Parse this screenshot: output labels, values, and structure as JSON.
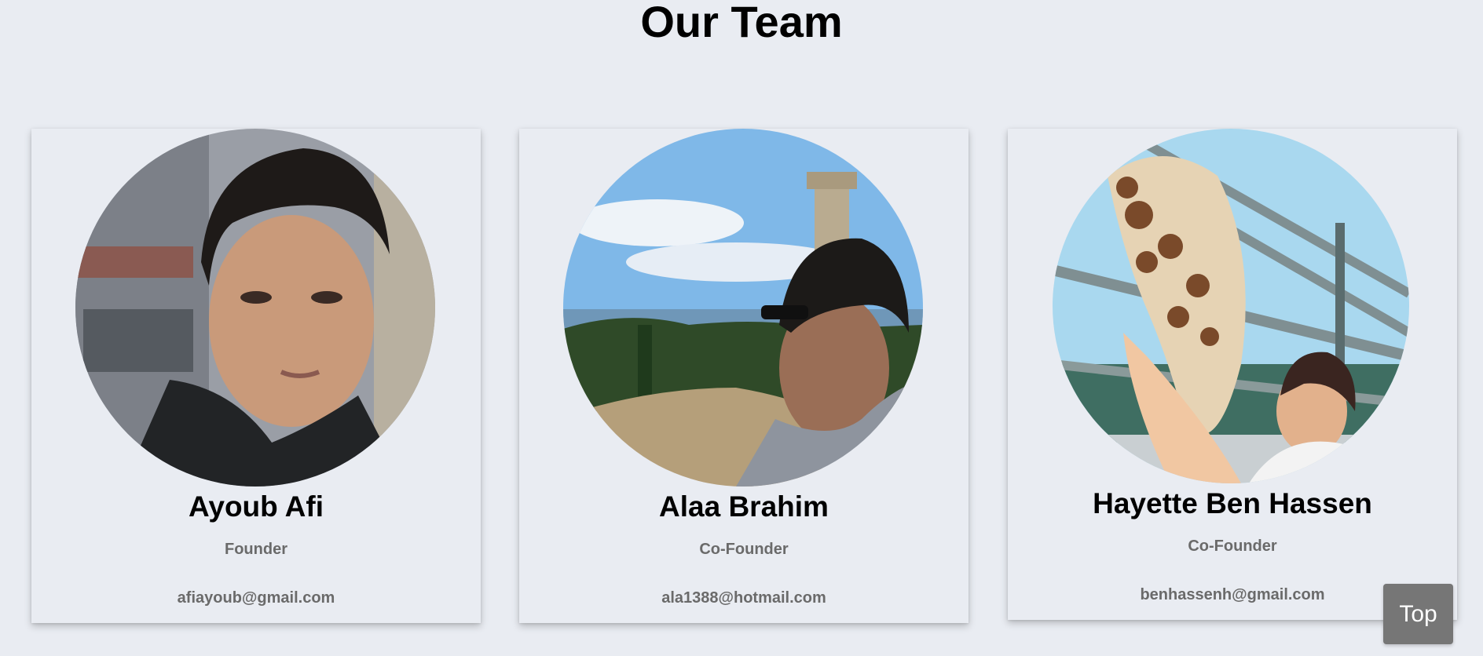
{
  "page": {
    "title": "Our Team"
  },
  "team": [
    {
      "name": "Ayoub Afi",
      "role": "Founder",
      "email": "afiayoub@gmail.com",
      "photo": "portrait-photo"
    },
    {
      "name": "Alaa Brahim",
      "role": "Co-Founder",
      "email": "ala1388@hotmail.com",
      "photo": "ruins-sea-photo"
    },
    {
      "name": "Hayette Ben Hassen",
      "role": "Co-Founder",
      "email": "benhassenh@gmail.com",
      "photo": "giraffe-photo"
    }
  ],
  "controls": {
    "top_label": "Top"
  },
  "colors": {
    "background": "#e9ecf2",
    "muted_text": "#6a6a6a",
    "button": "#767676"
  }
}
